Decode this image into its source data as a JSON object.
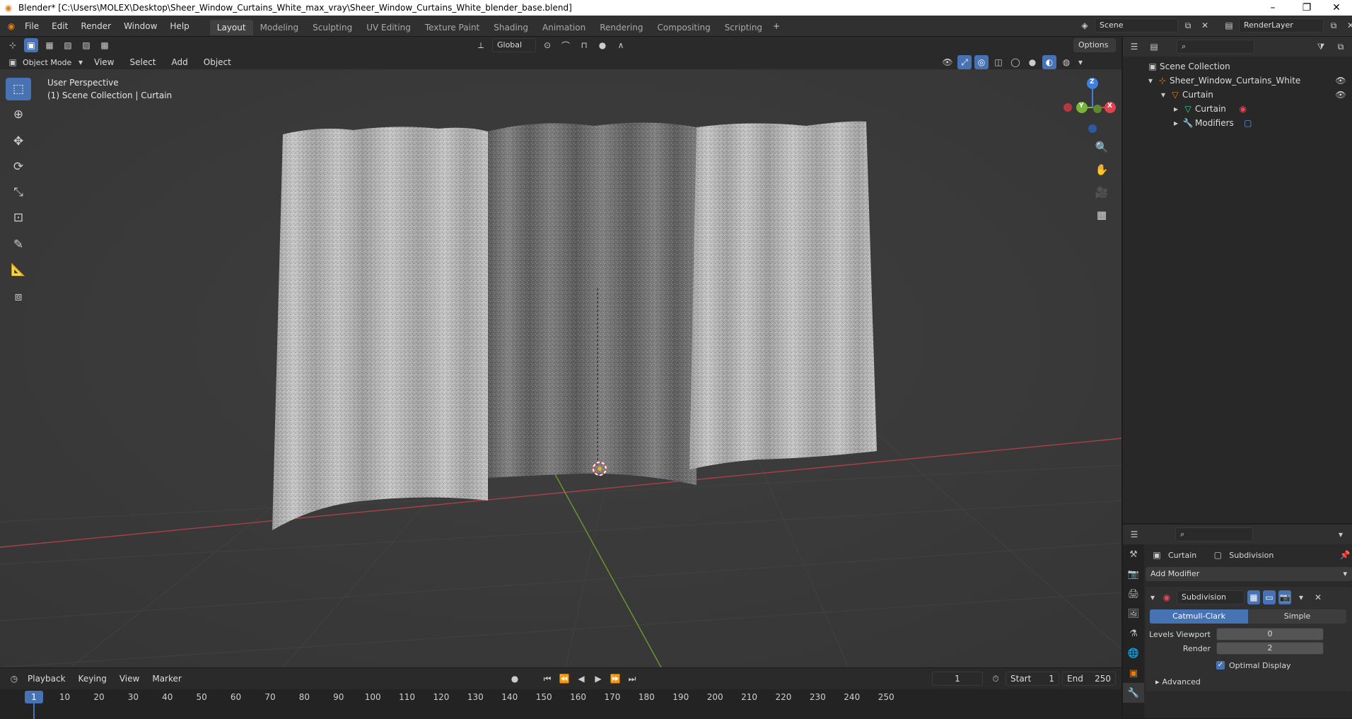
{
  "window": {
    "title": "Blender* [C:\\Users\\MOLEX\\Desktop\\Sheer_Window_Curtains_White_max_vray\\Sheer_Window_Curtains_White_blender_base.blend]"
  },
  "menu": [
    "File",
    "Edit",
    "Render",
    "Window",
    "Help"
  ],
  "workspaces": [
    "Layout",
    "Modeling",
    "Sculpting",
    "UV Editing",
    "Texture Paint",
    "Shading",
    "Animation",
    "Rendering",
    "Compositing",
    "Scripting"
  ],
  "active_workspace": "Layout",
  "scene": {
    "name": "Scene",
    "render_layer": "RenderLayer"
  },
  "viewport_header": {
    "transform_orientation": "Global",
    "options": "Options",
    "mode": "Object Mode",
    "menus": [
      "View",
      "Select",
      "Add",
      "Object"
    ]
  },
  "viewport": {
    "perspective": "User Perspective",
    "collection_info": "(1) Scene Collection | Curtain",
    "gizmo": {
      "x": "X",
      "y": "Y",
      "z": "Z"
    }
  },
  "outliner": {
    "root": "Scene Collection",
    "items": [
      {
        "label": "Sheer_Window_Curtains_White",
        "depth": 1
      },
      {
        "label": "Curtain",
        "depth": 2
      },
      {
        "label": "Curtain",
        "depth": 3
      },
      {
        "label": "Modifiers",
        "depth": 3
      }
    ]
  },
  "properties": {
    "breadcrumb_object": "Curtain",
    "breadcrumb_modifier": "Subdivision",
    "add_modifier": "Add Modifier",
    "modifier_name": "Subdivision",
    "algorithms": [
      "Catmull-Clark",
      "Simple"
    ],
    "active_algorithm": "Catmull-Clark",
    "levels_viewport_label": "Levels Viewport",
    "levels_viewport": "0",
    "render_label": "Render",
    "render": "2",
    "optimal_display": "Optimal Display",
    "advanced": "Advanced"
  },
  "timeline": {
    "menus": [
      "Playback",
      "Keying",
      "View",
      "Marker"
    ],
    "current_frame": "1",
    "start_label": "Start",
    "start": "1",
    "end_label": "End",
    "end": "250",
    "ruler": [
      "1",
      "10",
      "20",
      "30",
      "40",
      "50",
      "60",
      "70",
      "80",
      "90",
      "100",
      "110",
      "120",
      "130",
      "140",
      "150",
      "160",
      "170",
      "180",
      "190",
      "200",
      "210",
      "220",
      "230",
      "240",
      "250"
    ]
  },
  "colors": {
    "accent": "#4772b3",
    "axis_x": "#e0454f",
    "axis_y": "#7ab33a",
    "axis_z": "#3f7fe0",
    "playhead": "#4772b3"
  }
}
